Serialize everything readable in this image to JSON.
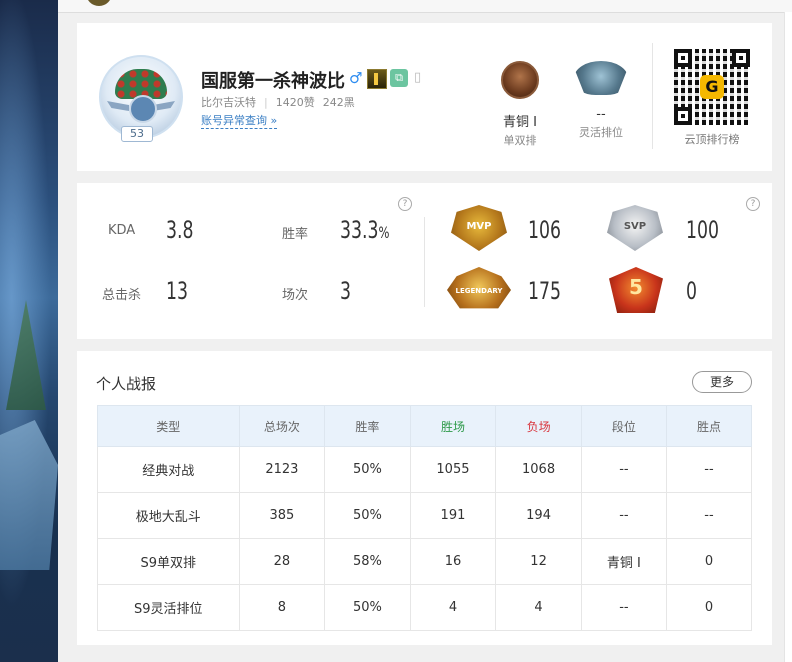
{
  "profile": {
    "name": "国服第一杀神波比",
    "gender_symbol": "♂",
    "level": "53",
    "server": "比尔吉沃特",
    "likes": "1420赞",
    "blacks": "242黑",
    "abnormal_link": "账号异常查询 »",
    "copy_icon_text": "⧉",
    "phone_icon_text": "▯"
  },
  "ranks": [
    {
      "tier": "青铜 Ⅰ",
      "type": "单双排"
    },
    {
      "tier": "--",
      "type": "灵活排位"
    }
  ],
  "qr": {
    "logo_letter": "G",
    "label": "云顶排行榜"
  },
  "stats": {
    "kda_label": "KDA",
    "kda_value": "3.8",
    "winrate_label": "胜率",
    "winrate_value": "33.3",
    "winrate_unit": "%",
    "kills_label": "总击杀",
    "kills_value": "13",
    "games_label": "场次",
    "games_value": "3",
    "help": "?"
  },
  "honors": {
    "mvp_text": "MVP",
    "mvp_value": "106",
    "svp_text": "SVP",
    "svp_value": "100",
    "legendary_text": "LEGENDARY",
    "legendary_value": "175",
    "five_text": "5",
    "five_value": "0"
  },
  "report": {
    "title": "个人战报",
    "more_label": "更多",
    "headers": [
      "类型",
      "总场次",
      "胜率",
      "胜场",
      "负场",
      "段位",
      "胜点"
    ],
    "rows": [
      [
        "经典对战",
        "2123",
        "50%",
        "1055",
        "1068",
        "--",
        "--"
      ],
      [
        "极地大乱斗",
        "385",
        "50%",
        "191",
        "194",
        "--",
        "--"
      ],
      [
        "S9单双排",
        "28",
        "58%",
        "16",
        "12",
        "青铜 Ⅰ",
        "0"
      ],
      [
        "S9灵活排位",
        "8",
        "50%",
        "4",
        "4",
        "--",
        "0"
      ]
    ]
  },
  "colors": {
    "win": "#2e9a4a",
    "lose": "#d9363e",
    "link": "#3b7fc4",
    "header_bg": "#e9f2fb"
  }
}
